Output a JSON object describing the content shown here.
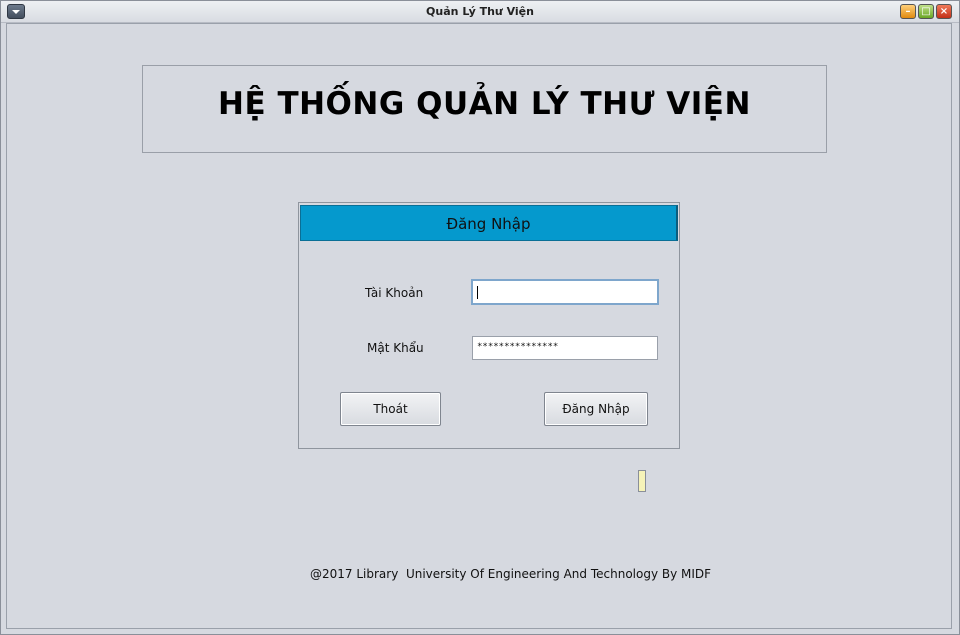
{
  "window": {
    "title": "Quản Lý Thư Viện",
    "controls": {
      "minimize": "–",
      "maximize": "□",
      "close": "×"
    }
  },
  "header": {
    "title": "HỆ THỐNG QUẢN LÝ THƯ VIỆN"
  },
  "login": {
    "panel_title": "Đăng Nhập",
    "username_label": "Tài Khoản",
    "username_value": "",
    "password_label": "Mật Khẩu",
    "password_value": "***************",
    "exit_button": "Thoát",
    "login_button": "Đăng Nhập"
  },
  "footer": {
    "text": "@2017 Library  University Of Engineering And Technology By MIDF"
  },
  "colors": {
    "panel_header": "#0599cd",
    "background": "#d6d9e0"
  }
}
